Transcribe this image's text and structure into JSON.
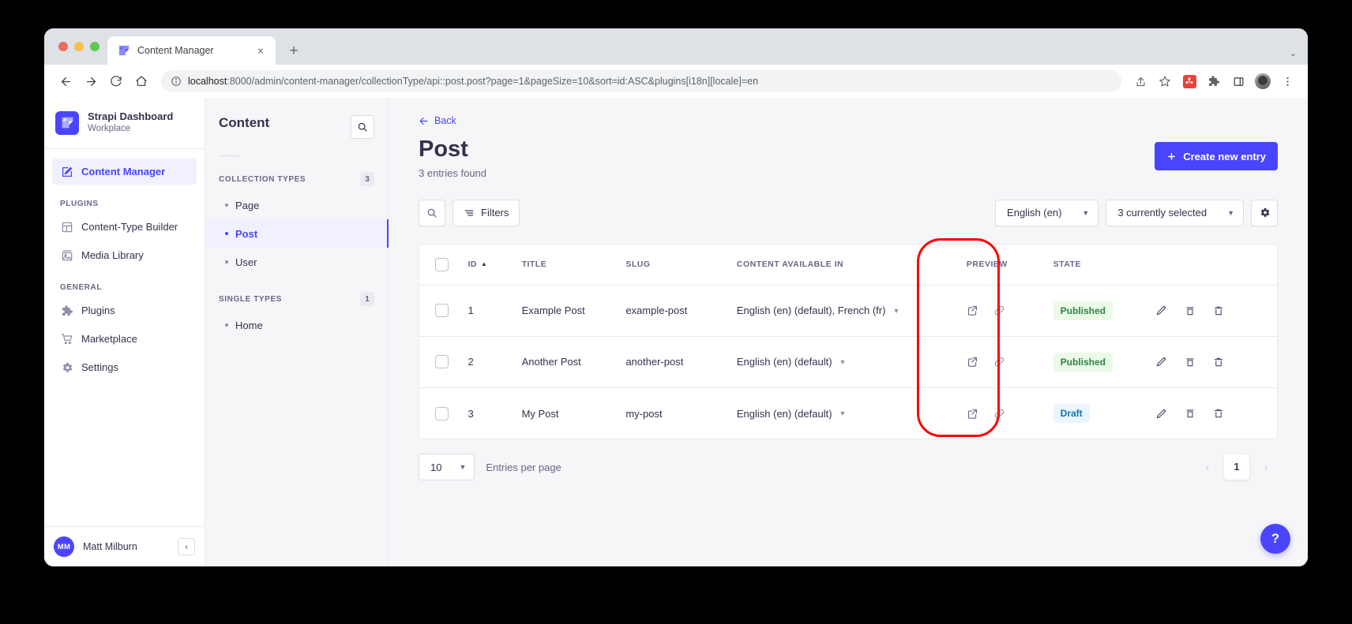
{
  "browser": {
    "tab": {
      "title": "Content Manager",
      "favicon": "strapi-logo-icon",
      "close": "×"
    },
    "new_tab_label": "+",
    "tabstrip_chevron": "⌄",
    "url_prefix": "localhost",
    "url_rest": ":8000/admin/content-manager/collectionType/api::post.post?page=1&pageSize=10&sort=id:ASC&plugins[i18n][locale]=en",
    "nav": {
      "back": "←",
      "forward": "→",
      "reload": "↻",
      "home": "⌂"
    }
  },
  "sidebar": {
    "brand": {
      "name": "Strapi Dashboard",
      "workplace": "Workplace"
    },
    "main_items": [
      {
        "label": "Content Manager",
        "icon": "pencil-square-icon",
        "active": true
      }
    ],
    "sections": [
      {
        "label": "PLUGINS",
        "items": [
          {
            "label": "Content-Type Builder",
            "icon": "layout-icon"
          },
          {
            "label": "Media Library",
            "icon": "image-icon"
          }
        ]
      },
      {
        "label": "GENERAL",
        "items": [
          {
            "label": "Plugins",
            "icon": "puzzle-icon"
          },
          {
            "label": "Marketplace",
            "icon": "shopping-cart-icon"
          },
          {
            "label": "Settings",
            "icon": "gear-icon"
          }
        ]
      }
    ],
    "user": {
      "initials": "MM",
      "name": "Matt Milburn",
      "collapse": "‹"
    }
  },
  "subnav": {
    "title": "Content",
    "search_icon": "search-icon",
    "groups": [
      {
        "label": "COLLECTION TYPES",
        "count": "3",
        "items": [
          {
            "label": "Page",
            "active": false
          },
          {
            "label": "Post",
            "active": true
          },
          {
            "label": "User",
            "active": false
          }
        ]
      },
      {
        "label": "SINGLE TYPES",
        "count": "1",
        "items": [
          {
            "label": "Home",
            "active": false
          }
        ]
      }
    ]
  },
  "main": {
    "back_label": "Back",
    "title": "Post",
    "entries_found": "3 entries found",
    "create_button": "Create new entry",
    "create_button_icon": "plus-icon",
    "search_icon": "search-icon",
    "filters_label": "Filters",
    "filters_icon": "filter-icon",
    "locale_select": "English (en)",
    "fields_select": "3 currently selected",
    "settings_icon": "gear-icon",
    "columns": [
      "ID",
      "TITLE",
      "SLUG",
      "CONTENT AVAILABLE IN",
      "PREVIEW",
      "STATE"
    ],
    "sort_indicator": "▲",
    "rows": [
      {
        "id": "1",
        "title": "Example Post",
        "slug": "example-post",
        "locales": "English (en) (default), French (fr)",
        "state": "Published",
        "state_kind": "published"
      },
      {
        "id": "2",
        "title": "Another Post",
        "slug": "another-post",
        "locales": "English (en) (default)",
        "state": "Published",
        "state_kind": "published"
      },
      {
        "id": "3",
        "title": "My Post",
        "slug": "my-post",
        "locales": "English (en) (default)",
        "state": "Draft",
        "state_kind": "draft"
      }
    ],
    "row_action_icons": [
      "edit-pencil-icon",
      "duplicate-icon",
      "delete-trash-icon"
    ],
    "preview_action_icons": [
      "open-external-icon",
      "copy-link-icon"
    ],
    "pagination": {
      "page_size": "10",
      "entries_per_page_label": "Entries per page",
      "prev": "‹",
      "current_page": "1",
      "next": "›"
    },
    "help_button": "?"
  },
  "colors": {
    "brand_primary": "#4945ff",
    "published_bg": "#eafbe7",
    "published_fg": "#328048",
    "draft_bg": "#eaf5ff",
    "draft_fg": "#0c75af",
    "annotation_red": "#ff0000"
  }
}
